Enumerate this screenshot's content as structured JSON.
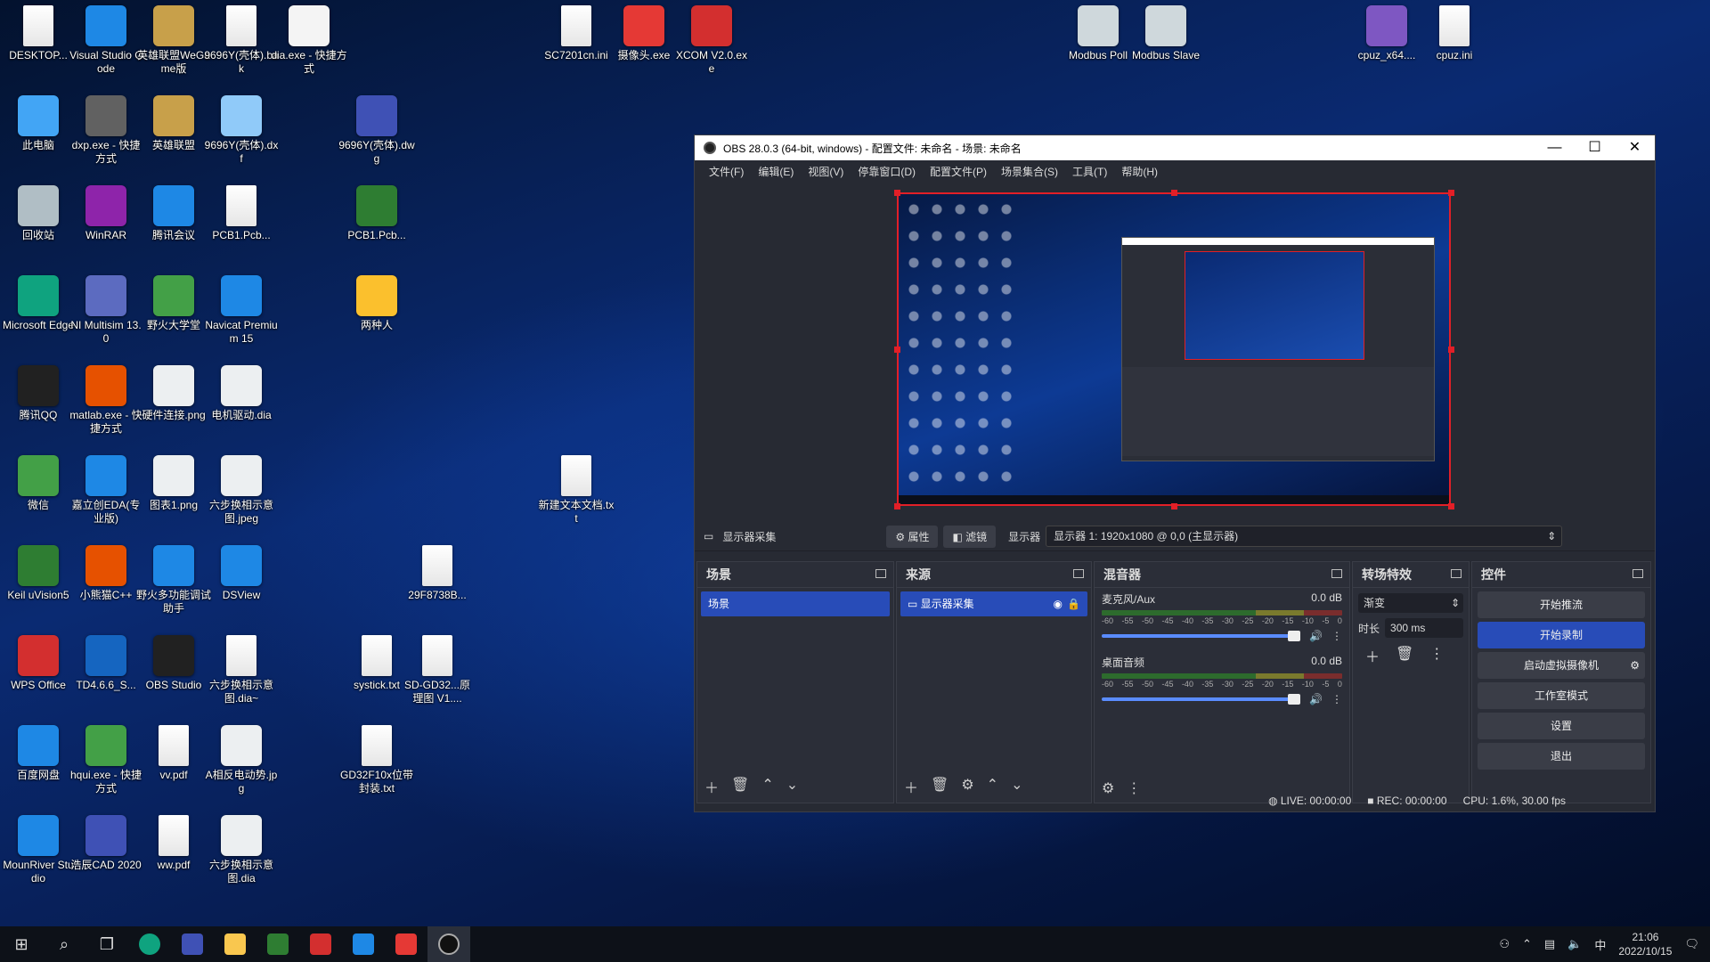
{
  "desktop_icons": [
    {
      "label": "DESKTOP...",
      "color": "#ffffff",
      "icon": "file-icon"
    },
    {
      "label": "Visual Studio Code",
      "color": "#1e88e5",
      "icon": "vscode-icon"
    },
    {
      "label": "英雄联盟WeGame版",
      "color": "#c8a04a",
      "icon": "lol-icon"
    },
    {
      "label": "9696Y(壳体).bak",
      "color": "#ffffff",
      "icon": "file-icon"
    },
    {
      "label": "dia.exe - 快捷方式",
      "color": "#f4f4f4",
      "icon": "dia-icon"
    },
    {
      "label": "SC7201cn.ini",
      "color": "#ffffff",
      "icon": "ini-icon"
    },
    {
      "label": "摄像头.exe",
      "color": "#e53935",
      "icon": "camera-icon"
    },
    {
      "label": "XCOM V2.0.exe",
      "color": "#d32f2f",
      "icon": "xcom-icon"
    },
    {
      "label": "Modbus Poll",
      "color": "#cfd8dc",
      "icon": "modbus-poll-icon"
    },
    {
      "label": "Modbus Slave",
      "color": "#cfd8dc",
      "icon": "modbus-slave-icon"
    },
    {
      "label": "cpuz_x64....",
      "color": "#7e57c2",
      "icon": "cpuz-icon"
    },
    {
      "label": "cpuz.ini",
      "color": "#ffffff",
      "icon": "ini-icon"
    },
    {
      "label": "此电脑",
      "color": "#42a5f5",
      "icon": "computer-icon"
    },
    {
      "label": "dxp.exe - 快捷方式",
      "color": "#616161",
      "icon": "dxp-icon"
    },
    {
      "label": "英雄联盟",
      "color": "#c8a04a",
      "icon": "lol-icon"
    },
    {
      "label": "9696Y(壳体).dxf",
      "color": "#90caf9",
      "icon": "dxf-icon"
    },
    {
      "label": "9696Y(壳体).dwg",
      "color": "#3f51b5",
      "icon": "cad-icon"
    },
    {
      "label": "回收站",
      "color": "#b0bec5",
      "icon": "recycle-bin-icon"
    },
    {
      "label": "WinRAR",
      "color": "#8e24aa",
      "icon": "winrar-icon"
    },
    {
      "label": "腾讯会议",
      "color": "#1e88e5",
      "icon": "tencent-meeting-icon"
    },
    {
      "label": "PCB1.Pcb...",
      "color": "#ffffff",
      "icon": "file-icon"
    },
    {
      "label": "PCB1.Pcb...",
      "color": "#2e7d32",
      "icon": "pcb-icon"
    },
    {
      "label": "Microsoft Edge",
      "color": "#0fa37f",
      "icon": "edge-icon"
    },
    {
      "label": "NI Multisim 13.0",
      "color": "#5c6bc0",
      "icon": "multisim-icon"
    },
    {
      "label": "野火大学堂",
      "color": "#43a047",
      "icon": "fire-icon"
    },
    {
      "label": "Navicat Premium 15",
      "color": "#1e88e5",
      "icon": "navicat-icon"
    },
    {
      "label": "两种人",
      "color": "#fbc02d",
      "icon": "archive-icon"
    },
    {
      "label": "腾讯QQ",
      "color": "#212121",
      "icon": "qq-icon"
    },
    {
      "label": "matlab.exe - 快捷方式",
      "color": "#e65100",
      "icon": "matlab-icon"
    },
    {
      "label": "硬件连接.png",
      "color": "#eceff1",
      "icon": "image-icon"
    },
    {
      "label": "电机驱动.dia",
      "color": "#eceff1",
      "icon": "dia-file-icon"
    },
    {
      "label": "新建文本文档.txt",
      "color": "#ffffff",
      "icon": "txt-icon"
    },
    {
      "label": "微信",
      "color": "#43a047",
      "icon": "wechat-icon"
    },
    {
      "label": "嘉立创EDA(专业版)",
      "color": "#1e88e5",
      "icon": "eda-icon"
    },
    {
      "label": "图表1.png",
      "color": "#eceff1",
      "icon": "image-icon"
    },
    {
      "label": "六步换相示意图.jpeg",
      "color": "#eceff1",
      "icon": "image-icon"
    },
    {
      "label": "Keil uVision5",
      "color": "#2e7d32",
      "icon": "keil-icon"
    },
    {
      "label": "小熊猫C++",
      "color": "#e65100",
      "icon": "redpanda-icon"
    },
    {
      "label": "野火多功能调试助手",
      "color": "#1e88e5",
      "icon": "debug-assistant-icon"
    },
    {
      "label": "DSView",
      "color": "#1e88e5",
      "icon": "dsview-icon"
    },
    {
      "label": "29F8738B...",
      "color": "#546e7a",
      "icon": "file-icon"
    },
    {
      "label": "WPS Office",
      "color": "#d32f2f",
      "icon": "wps-icon"
    },
    {
      "label": "TD4.6.6_S...",
      "color": "#1565c0",
      "icon": "td-icon"
    },
    {
      "label": "OBS Studio",
      "color": "#212121",
      "icon": "obs-icon"
    },
    {
      "label": "六步换相示意图.dia~",
      "color": "#ffffff",
      "icon": "file-icon"
    },
    {
      "label": "systick.txt",
      "color": "#ffffff",
      "icon": "txt-icon"
    },
    {
      "label": "SD-GD32...原理图 V1....",
      "color": "#ffffff",
      "icon": "pdf-icon"
    },
    {
      "label": "百度网盘",
      "color": "#1e88e5",
      "icon": "baidu-netdisk-icon"
    },
    {
      "label": "hqui.exe - 快捷方式",
      "color": "#43a047",
      "icon": "hqui-icon"
    },
    {
      "label": "vv.pdf",
      "color": "#ffffff",
      "icon": "pdf-icon"
    },
    {
      "label": "A相反电动势.jpg",
      "color": "#eceff1",
      "icon": "image-icon"
    },
    {
      "label": "GD32F10x位带封装.txt",
      "color": "#ffffff",
      "icon": "txt-icon"
    },
    {
      "label": "MounRiver Studio",
      "color": "#1e88e5",
      "icon": "mounriver-icon"
    },
    {
      "label": "浩辰CAD 2020",
      "color": "#3f51b5",
      "icon": "cad-icon"
    },
    {
      "label": "ww.pdf",
      "color": "#ffffff",
      "icon": "pdf-icon"
    },
    {
      "label": "六步换相示意图.dia",
      "color": "#eceff1",
      "icon": "dia-file-icon"
    }
  ],
  "obs": {
    "title": "OBS 28.0.3 (64-bit, windows) - 配置文件: 未命名 - 场景: 未命名",
    "window_buttons": {
      "minimize": "—",
      "maximize": "☐",
      "close": "✕"
    },
    "menu": [
      "文件(F)",
      "编辑(E)",
      "视图(V)",
      "停靠窗口(D)",
      "配置文件(P)",
      "场景集合(S)",
      "工具(T)",
      "帮助(H)"
    ],
    "source_bar": {
      "source_name": "显示器采集",
      "properties": "属性",
      "filters": "滤镜",
      "display_label": "显示器",
      "display_value": "显示器 1: 1920x1080 @ 0,0 (主显示器)"
    },
    "scenes": {
      "title": "场景",
      "items": [
        "场景"
      ]
    },
    "sources": {
      "title": "来源",
      "items": [
        "显示器采集"
      ]
    },
    "mixer": {
      "title": "混音器",
      "channels": [
        {
          "name": "麦克风/Aux",
          "db": "0.0 dB"
        },
        {
          "name": "桌面音频",
          "db": "0.0 dB"
        }
      ],
      "ticks": [
        "-60",
        "-55",
        "-50",
        "-45",
        "-40",
        "-35",
        "-30",
        "-25",
        "-20",
        "-15",
        "-10",
        "-5",
        "0"
      ]
    },
    "transitions": {
      "title": "转场特效",
      "type": "渐变",
      "duration_label": "时长",
      "duration_value": "300 ms"
    },
    "controls": {
      "title": "控件",
      "start_streaming": "开始推流",
      "start_recording": "开始录制",
      "virtual_camera": "启动虚拟摄像机",
      "studio_mode": "工作室模式",
      "settings": "设置",
      "exit": "退出"
    },
    "status": {
      "live": "LIVE: 00:00:00",
      "rec": "REC: 00:00:00",
      "cpu": "CPU: 1.6%, 30.00 fps"
    }
  },
  "taskbar": {
    "apps": [
      "edge",
      "cad",
      "explorer",
      "keil",
      "wps",
      "dsview",
      "camera",
      "obs"
    ],
    "ime": "中",
    "time": "21:06",
    "date": "2022/10/15"
  },
  "colors": {
    "accent": "#284cb8",
    "preview_border": "#e21f27",
    "obs_bg": "#272a33"
  }
}
